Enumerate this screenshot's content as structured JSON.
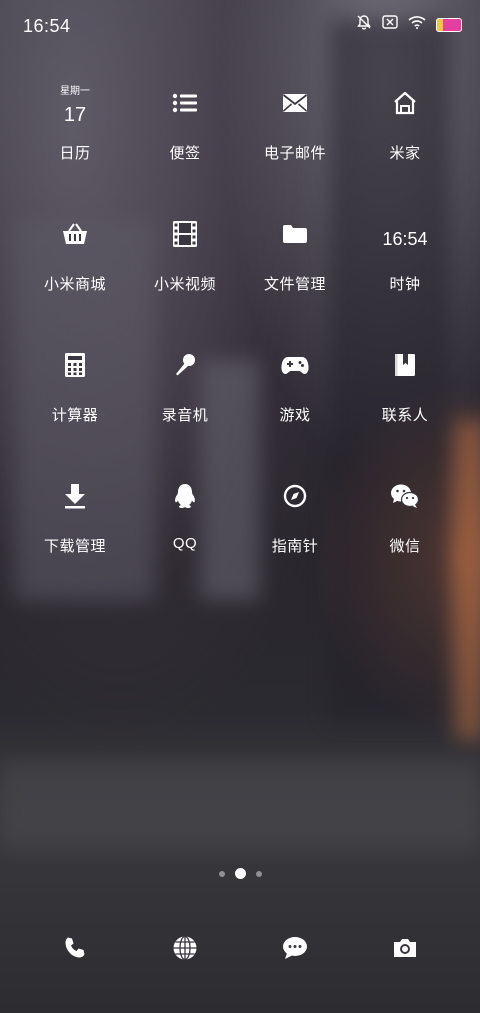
{
  "status_bar": {
    "time": "16:54",
    "icons": [
      "bell-muted-icon",
      "no-sim-icon",
      "wifi-icon",
      "battery-icon"
    ]
  },
  "calendar_widget": {
    "weekday": "星期一",
    "day": "17"
  },
  "clock_widget": {
    "time": "16:54"
  },
  "apps": [
    {
      "label": "日历",
      "icon": "calendar-icon"
    },
    {
      "label": "便签",
      "icon": "notes-icon"
    },
    {
      "label": "电子邮件",
      "icon": "mail-icon"
    },
    {
      "label": "米家",
      "icon": "home-icon"
    },
    {
      "label": "小米商城",
      "icon": "shopping-basket-icon"
    },
    {
      "label": "小米视频",
      "icon": "film-icon"
    },
    {
      "label": "文件管理",
      "icon": "folder-icon"
    },
    {
      "label": "时钟",
      "icon": "clock-icon"
    },
    {
      "label": "计算器",
      "icon": "calculator-icon"
    },
    {
      "label": "录音机",
      "icon": "microphone-icon"
    },
    {
      "label": "游戏",
      "icon": "gamepad-icon"
    },
    {
      "label": "联系人",
      "icon": "contacts-book-icon"
    },
    {
      "label": "下载管理",
      "icon": "download-icon"
    },
    {
      "label": "QQ",
      "icon": "qq-penguin-icon"
    },
    {
      "label": "指南针",
      "icon": "compass-icon"
    },
    {
      "label": "微信",
      "icon": "wechat-icon"
    }
  ],
  "page_indicator": {
    "count": 3,
    "active": 2
  },
  "dock": [
    {
      "icon": "phone-icon"
    },
    {
      "icon": "browser-globe-icon"
    },
    {
      "icon": "messages-icon"
    },
    {
      "icon": "camera-icon"
    }
  ]
}
